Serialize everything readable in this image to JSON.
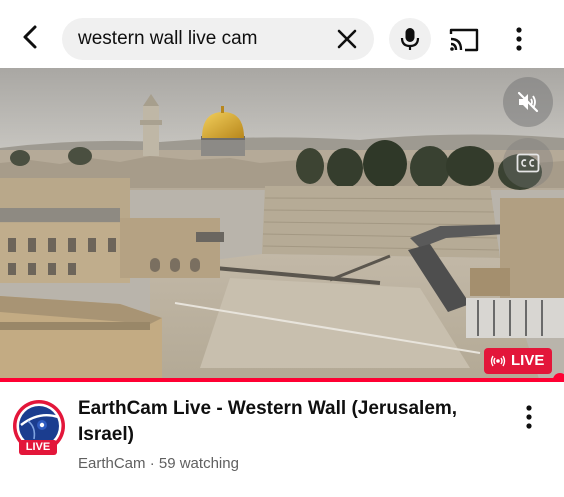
{
  "search": {
    "query": "western wall live cam"
  },
  "player": {
    "live_label": "LIVE",
    "progress_fraction": 0.993
  },
  "video": {
    "title": "EarthCam Live - Western Wall  (Jerusalem, Israel)",
    "channel_name": "EarthCam",
    "separator": " · ",
    "viewers": "59 watching",
    "avatar_live_tag": "LIVE"
  },
  "colors": {
    "live_red": "#e3163a",
    "progress_red": "#ff0033",
    "dome_gold": "#d4a72c"
  },
  "icons": [
    "back-arrow-icon",
    "close-icon",
    "mic-icon",
    "cast-icon",
    "more-vert-icon",
    "volume-muted-icon",
    "closed-captions-icon",
    "live-broadcast-icon"
  ]
}
